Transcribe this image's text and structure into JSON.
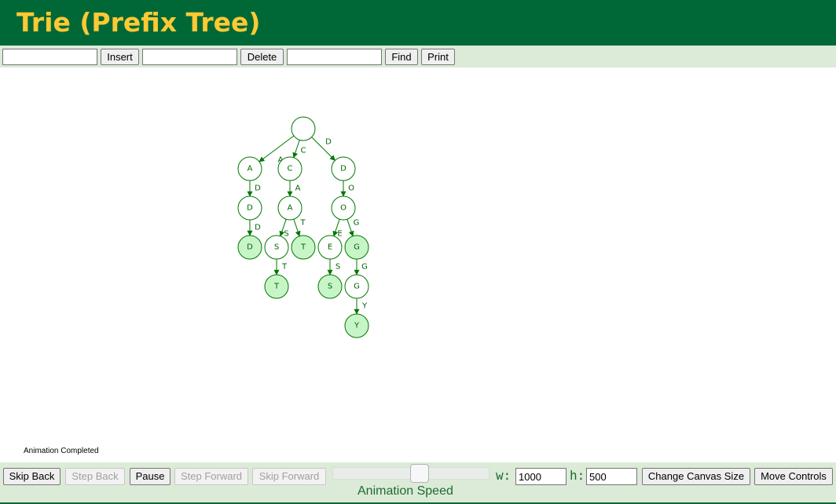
{
  "header": {
    "title": "Trie (Prefix Tree)"
  },
  "colors": {
    "header_bg": "#006837",
    "title": "#ffc933",
    "controls_bg": "#dcebd8",
    "node_stroke": "#007700",
    "word_end_fill": "#c8f5c8"
  },
  "controls": {
    "insert_input": "",
    "insert_label": "Insert",
    "delete_input": "",
    "delete_label": "Delete",
    "find_input": "",
    "find_label": "Find",
    "print_label": "Print"
  },
  "status": "Animation Completed",
  "animation": {
    "skip_back": "Skip Back",
    "step_back": "Step Back",
    "pause": "Pause",
    "step_forward": "Step Forward",
    "skip_forward": "Skip Forward",
    "speed_label": "Animation Speed",
    "speed_value": 0.56,
    "width_label": "w:",
    "width_value": "1000",
    "height_label": "h:",
    "height_value": "500",
    "change_size": "Change Canvas Size",
    "move_controls": "Move Controls"
  },
  "trie": {
    "nodes": [
      {
        "id": "root",
        "label": "",
        "end": false
      },
      {
        "id": "A",
        "label": "A",
        "end": false
      },
      {
        "id": "AD",
        "label": "D",
        "end": false
      },
      {
        "id": "ADD",
        "label": "D",
        "end": true
      },
      {
        "id": "C",
        "label": "C",
        "end": false
      },
      {
        "id": "CA",
        "label": "A",
        "end": false
      },
      {
        "id": "CAS",
        "label": "S",
        "end": false
      },
      {
        "id": "CAST",
        "label": "T",
        "end": true
      },
      {
        "id": "CAT",
        "label": "T",
        "end": true
      },
      {
        "id": "D",
        "label": "D",
        "end": false
      },
      {
        "id": "DO",
        "label": "O",
        "end": false
      },
      {
        "id": "DOE",
        "label": "E",
        "end": false
      },
      {
        "id": "DOES",
        "label": "S",
        "end": true
      },
      {
        "id": "DOG",
        "label": "G",
        "end": true
      },
      {
        "id": "DOGG",
        "label": "G",
        "end": false
      },
      {
        "id": "DOGGY",
        "label": "Y",
        "end": true
      }
    ],
    "edges": [
      {
        "from": "root",
        "to": "A",
        "label": "A"
      },
      {
        "from": "root",
        "to": "C",
        "label": "C"
      },
      {
        "from": "root",
        "to": "D",
        "label": "D"
      },
      {
        "from": "A",
        "to": "AD",
        "label": "D"
      },
      {
        "from": "AD",
        "to": "ADD",
        "label": "D"
      },
      {
        "from": "C",
        "to": "CA",
        "label": "A"
      },
      {
        "from": "CA",
        "to": "CAS",
        "label": "S"
      },
      {
        "from": "CA",
        "to": "CAT",
        "label": "T"
      },
      {
        "from": "CAS",
        "to": "CAST",
        "label": "T"
      },
      {
        "from": "D",
        "to": "DO",
        "label": "O"
      },
      {
        "from": "DO",
        "to": "DOE",
        "label": "E"
      },
      {
        "from": "DO",
        "to": "DOG",
        "label": "G"
      },
      {
        "from": "DOE",
        "to": "DOES",
        "label": "S"
      },
      {
        "from": "DOG",
        "to": "DOGG",
        "label": "G"
      },
      {
        "from": "DOGG",
        "to": "DOGGY",
        "label": "Y"
      }
    ]
  }
}
